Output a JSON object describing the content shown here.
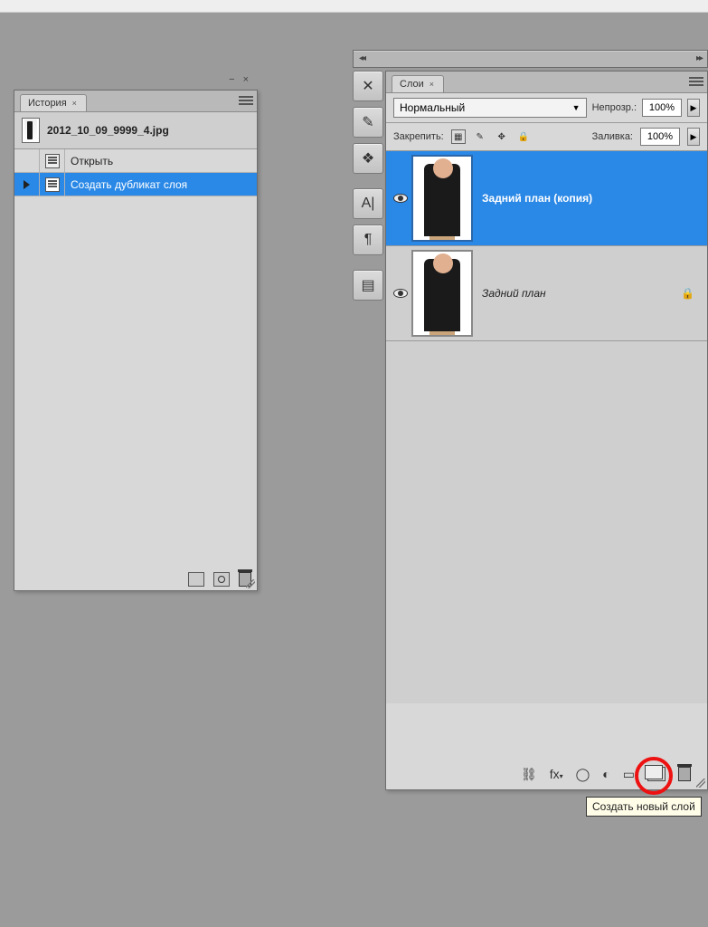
{
  "history_panel": {
    "tab_label": "История",
    "filename": "2012_10_09_9999_4.jpg",
    "items": [
      {
        "label": "Открыть",
        "selected": false
      },
      {
        "label": "Создать дубликат слоя",
        "selected": true
      }
    ]
  },
  "layers_panel": {
    "tab_label": "Слои",
    "blend_mode": "Нормальный",
    "opacity_label": "Непрозр.:",
    "opacity_value": "100%",
    "lock_label": "Закрепить:",
    "fill_label": "Заливка:",
    "fill_value": "100%",
    "layers": [
      {
        "name": "Задний план (копия)",
        "selected": true,
        "locked": false
      },
      {
        "name": "Задний план",
        "selected": false,
        "locked": true
      }
    ]
  },
  "tooltip": "Создать новый слой",
  "icons": {
    "link": "⛓",
    "fx": "fx",
    "mask": "◯",
    "adjust": "◐",
    "group": "▭",
    "lock": "🔒"
  }
}
